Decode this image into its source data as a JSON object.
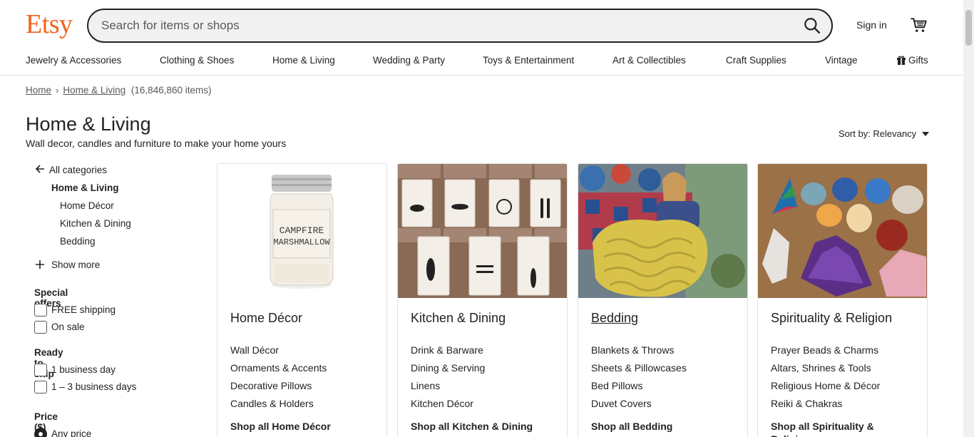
{
  "header": {
    "logo": "Etsy",
    "search_placeholder": "Search for items or shops",
    "sign_in": "Sign in"
  },
  "categories": [
    "Jewelry & Accessories",
    "Clothing & Shoes",
    "Home & Living",
    "Wedding & Party",
    "Toys & Entertainment",
    "Art & Collectibles",
    "Craft Supplies",
    "Vintage",
    "Gifts"
  ],
  "breadcrumb": {
    "home": "Home",
    "current": "Home & Living",
    "count": "(16,846,860 items)"
  },
  "page": {
    "title": "Home & Living",
    "subtitle": "Wall decor, candles and furniture to make your home yours",
    "sort_label": "Sort by: Relevancy"
  },
  "sidebar": {
    "all_categories": "All categories",
    "current": "Home & Living",
    "subcategories": [
      "Home Décor",
      "Kitchen & Dining",
      "Bedding"
    ],
    "show_more": "Show more",
    "special_offers": {
      "heading": "Special offers",
      "options": [
        "FREE shipping",
        "On sale"
      ]
    },
    "ready_to_ship": {
      "heading": "Ready to ship in",
      "options": [
        "1 business day",
        "1 – 3 business days"
      ]
    },
    "price": {
      "heading": "Price ($)",
      "selected": "Any price"
    }
  },
  "cards": [
    {
      "title": "Home Décor",
      "links": [
        "Wall Décor",
        "Ornaments & Accents",
        "Decorative Pillows",
        "Candles & Holders"
      ],
      "shop_all": "Shop all Home Décor",
      "image_text": [
        "CAMPFIRE",
        "MARSHMALLOW"
      ]
    },
    {
      "title": "Kitchen & Dining",
      "links": [
        "Drink & Barware",
        "Dining & Serving",
        "Linens",
        "Kitchen Décor"
      ],
      "shop_all": "Shop all Kitchen & Dining"
    },
    {
      "title": "Bedding",
      "links": [
        "Blankets & Throws",
        "Sheets & Pillowcases",
        "Bed Pillows",
        "Duvet Covers"
      ],
      "shop_all": "Shop all Bedding"
    },
    {
      "title": "Spirituality & Religion",
      "links": [
        "Prayer Beads & Charms",
        "Altars, Shrines & Tools",
        "Religious Home & Décor",
        "Reiki & Chakras"
      ],
      "shop_all": "Shop all Spirituality & Religion"
    }
  ],
  "colors": {
    "brand": "#F1641E",
    "text": "#222222",
    "muted": "#595959",
    "border": "#E1E1E1"
  }
}
